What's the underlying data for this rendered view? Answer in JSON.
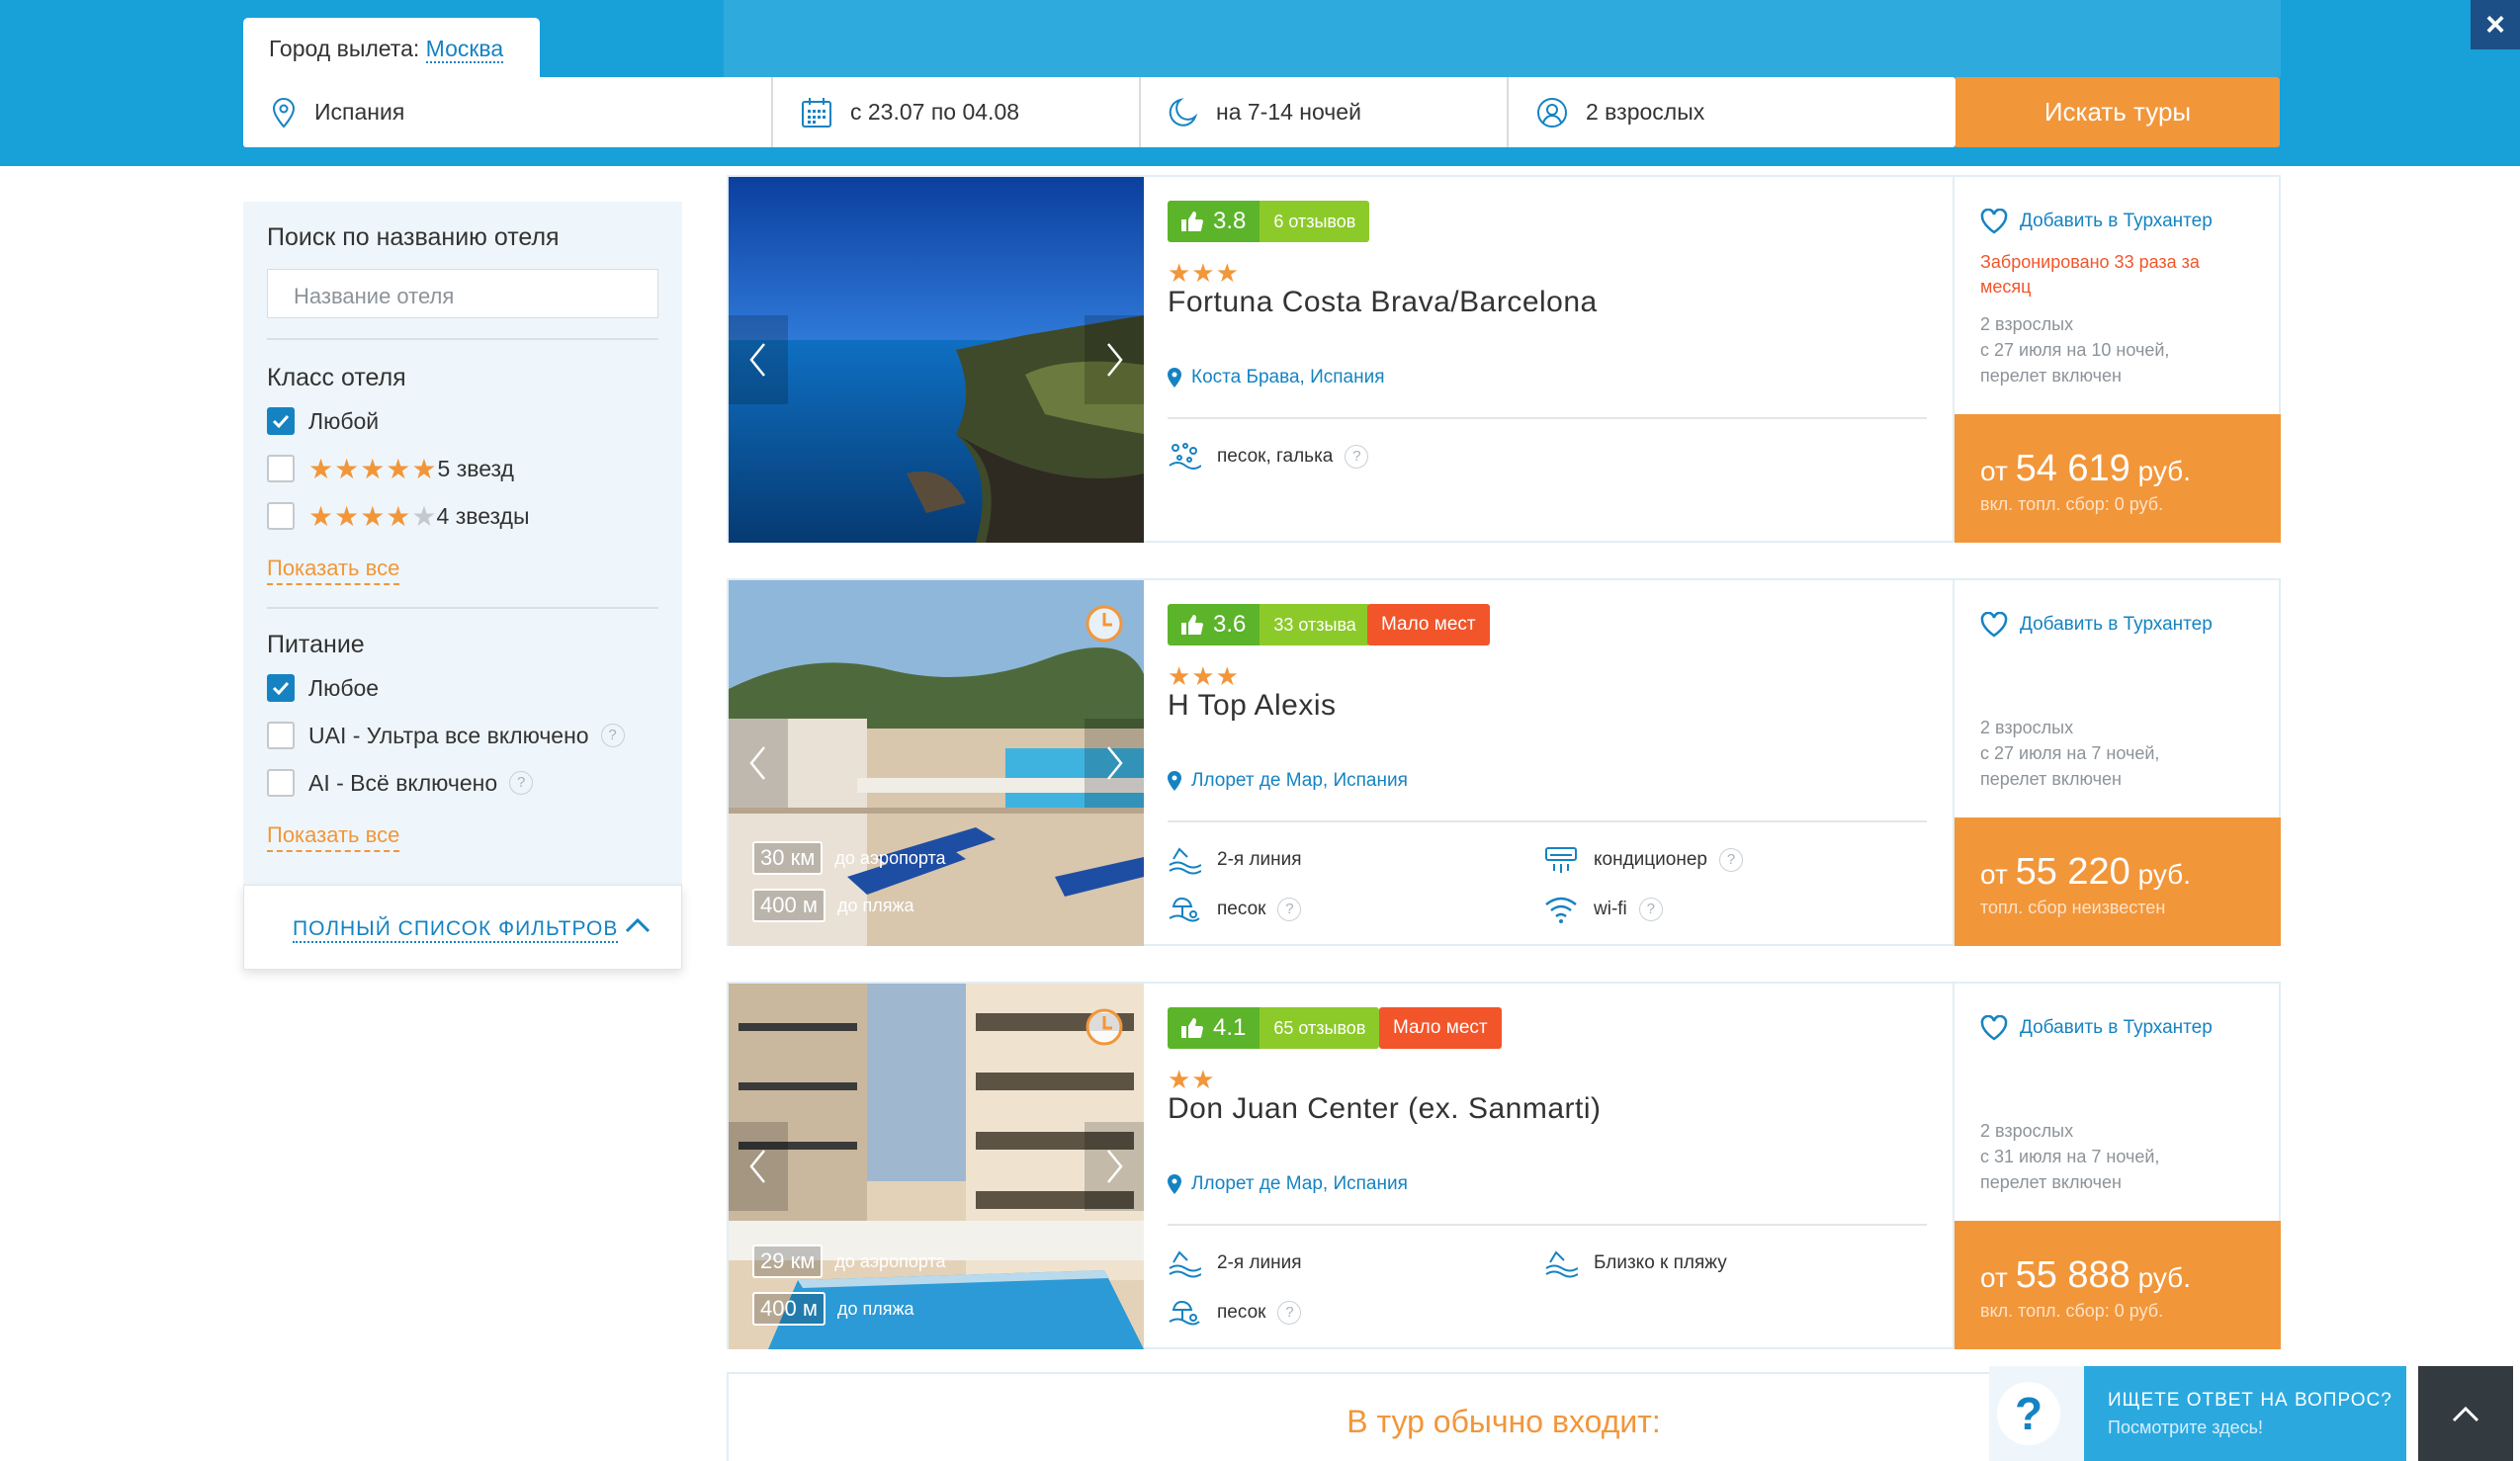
{
  "header": {
    "city_label": "Город вылета:",
    "city_value": "Москва",
    "destination": "Испания",
    "dates": "с 23.07 по 04.08",
    "nights": "на 7-14 ночей",
    "people": "2 взрослых",
    "search_button": "Искать туры",
    "close_icon": "close-icon",
    "colors": {
      "header_bg": "#17a1d8",
      "accent": "#f2963a"
    }
  },
  "sidebar": {
    "search_title": "Поиск по названию отеля",
    "search_placeholder": "Название отеля",
    "class_title": "Класс отеля",
    "class_options": [
      {
        "label": "Любой",
        "checked": true
      },
      {
        "label": "5 звезд",
        "checked": false,
        "stars": 5
      },
      {
        "label": "4 звезды",
        "checked": false,
        "stars": 4
      }
    ],
    "show_all_1": "Показать все",
    "food_title": "Питание",
    "food_options": [
      {
        "label": "Любое",
        "checked": true
      },
      {
        "label": "UAI - Ультра все включено",
        "checked": false
      },
      {
        "label": "AI - Всё включено",
        "checked": false
      }
    ],
    "show_all_2": "Показать все",
    "full_filters": "ПОЛНЫЙ СПИСОК ФИЛЬТРОВ"
  },
  "hotels": [
    {
      "rating": "3.8",
      "reviews": "6 отзывов",
      "stars": "★★★",
      "name": "Fortuna Costa Brava/Barcelona",
      "location": "Коста Брава, Испания",
      "features": [
        "песок, галька"
      ],
      "favorite": "Добавить в Турхантер",
      "booked": "Забронировано 33 раза за месяц",
      "tour_people": "2 взрослых",
      "tour_dates": "с 27 июля на 10 ночей,",
      "tour_flight": "перелет включен",
      "price_prefix": "от",
      "price": "54 619",
      "currency": "руб.",
      "fee": "вкл. топл. сбор: 0 руб."
    },
    {
      "rating": "3.6",
      "reviews": "33 отзыва",
      "badge": "Мало мест",
      "stars": "★★★",
      "name": "H Top Alexis",
      "location": "Ллорет де Мар, Испания",
      "features": [
        "2-я линия",
        "кондиционер",
        "песок",
        "wi-fi"
      ],
      "dist_airport": "30 км",
      "dist_airport_label": "до аэропорта",
      "dist_beach": "400 м",
      "dist_beach_label": "до пляжа",
      "favorite": "Добавить в Турхантер",
      "tour_people": "2 взрослых",
      "tour_dates": "с 27 июля на 7 ночей,",
      "tour_flight": "перелет включен",
      "price_prefix": "от",
      "price": "55 220",
      "currency": "руб.",
      "fee": "топл. сбор неизвестен"
    },
    {
      "rating": "4.1",
      "reviews": "65 отзывов",
      "badge": "Мало мест",
      "stars": "★★",
      "name": "Don Juan Center (ex. Sanmarti)",
      "location": "Ллорет де Мар, Испания",
      "features": [
        "2-я линия",
        "Близко к пляжу",
        "песок"
      ],
      "dist_airport": "29 км",
      "dist_airport_label": "до аэропорта",
      "dist_beach": "400 м",
      "dist_beach_label": "до пляжа",
      "favorite": "Добавить в Турхантер",
      "tour_people": "2 взрослых",
      "tour_dates": "с 31 июля на 7 ночей,",
      "tour_flight": "перелет включен",
      "price_prefix": "от",
      "price": "55 888",
      "currency": "руб.",
      "fee": "вкл. топл. сбор: 0 руб."
    }
  ],
  "included_title": "В тур обычно входит:",
  "help": {
    "title": "ИЩЕТЕ ОТВЕТ НА ВОПРОС?",
    "subtitle": "Посмотрите здесь!"
  }
}
